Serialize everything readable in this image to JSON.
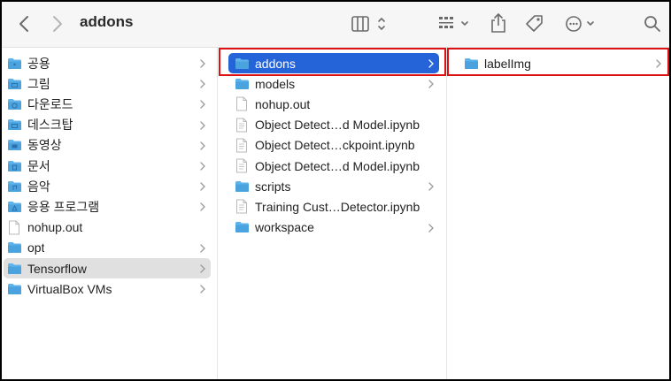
{
  "window": {
    "title": "addons"
  },
  "sidebar_col": {
    "items": [
      {
        "label": "공용",
        "icon": "public-folder-icon",
        "has_chevron": true
      },
      {
        "label": "그림",
        "icon": "pictures-folder-icon",
        "has_chevron": true
      },
      {
        "label": "다운로드",
        "icon": "downloads-folder-icon",
        "has_chevron": true
      },
      {
        "label": "데스크탑",
        "icon": "desktop-folder-icon",
        "has_chevron": true
      },
      {
        "label": "동영상",
        "icon": "movies-folder-icon",
        "has_chevron": true
      },
      {
        "label": "문서",
        "icon": "documents-folder-icon",
        "has_chevron": true
      },
      {
        "label": "음악",
        "icon": "music-folder-icon",
        "has_chevron": true
      },
      {
        "label": "응용 프로그램",
        "icon": "applications-folder-icon",
        "has_chevron": true
      },
      {
        "label": "nohup.out",
        "icon": "file-icon",
        "has_chevron": false
      },
      {
        "label": "opt",
        "icon": "folder-icon",
        "has_chevron": true
      },
      {
        "label": "Tensorflow",
        "icon": "folder-icon",
        "has_chevron": true
      },
      {
        "label": "VirtualBox VMs",
        "icon": "folder-icon",
        "has_chevron": true
      }
    ]
  },
  "middle_col": {
    "items": [
      {
        "label": "addons",
        "icon": "folder-icon",
        "has_chevron": true
      },
      {
        "label": "models",
        "icon": "folder-icon",
        "has_chevron": true
      },
      {
        "label": "nohup.out",
        "icon": "file-icon",
        "has_chevron": false
      },
      {
        "label": "Object Detect…d Model.ipynb",
        "icon": "notebook-file-icon",
        "has_chevron": false
      },
      {
        "label": "Object Detect…ckpoint.ipynb",
        "icon": "notebook-file-icon",
        "has_chevron": false
      },
      {
        "label": "Object Detect…d Model.ipynb",
        "icon": "notebook-file-icon",
        "has_chevron": false
      },
      {
        "label": "scripts",
        "icon": "folder-icon",
        "has_chevron": true
      },
      {
        "label": "Training Cust…Detector.ipynb",
        "icon": "notebook-file-icon",
        "has_chevron": false
      },
      {
        "label": "workspace",
        "icon": "folder-icon",
        "has_chevron": true
      }
    ]
  },
  "right_col": {
    "items": [
      {
        "label": "labelImg",
        "icon": "folder-icon",
        "has_chevron": true
      }
    ]
  },
  "selection": {
    "sidebar_selected": "Tensorflow",
    "middle_selected": "addons"
  },
  "colors": {
    "selection_blue": "#2463d8",
    "folder_blue": "#4aa3df",
    "highlight_red": "#dd1111"
  },
  "toolbar_icons": [
    "back-icon",
    "forward-icon",
    "column-view-icon",
    "group-icon",
    "share-icon",
    "tag-icon",
    "more-actions-icon",
    "search-icon"
  ]
}
